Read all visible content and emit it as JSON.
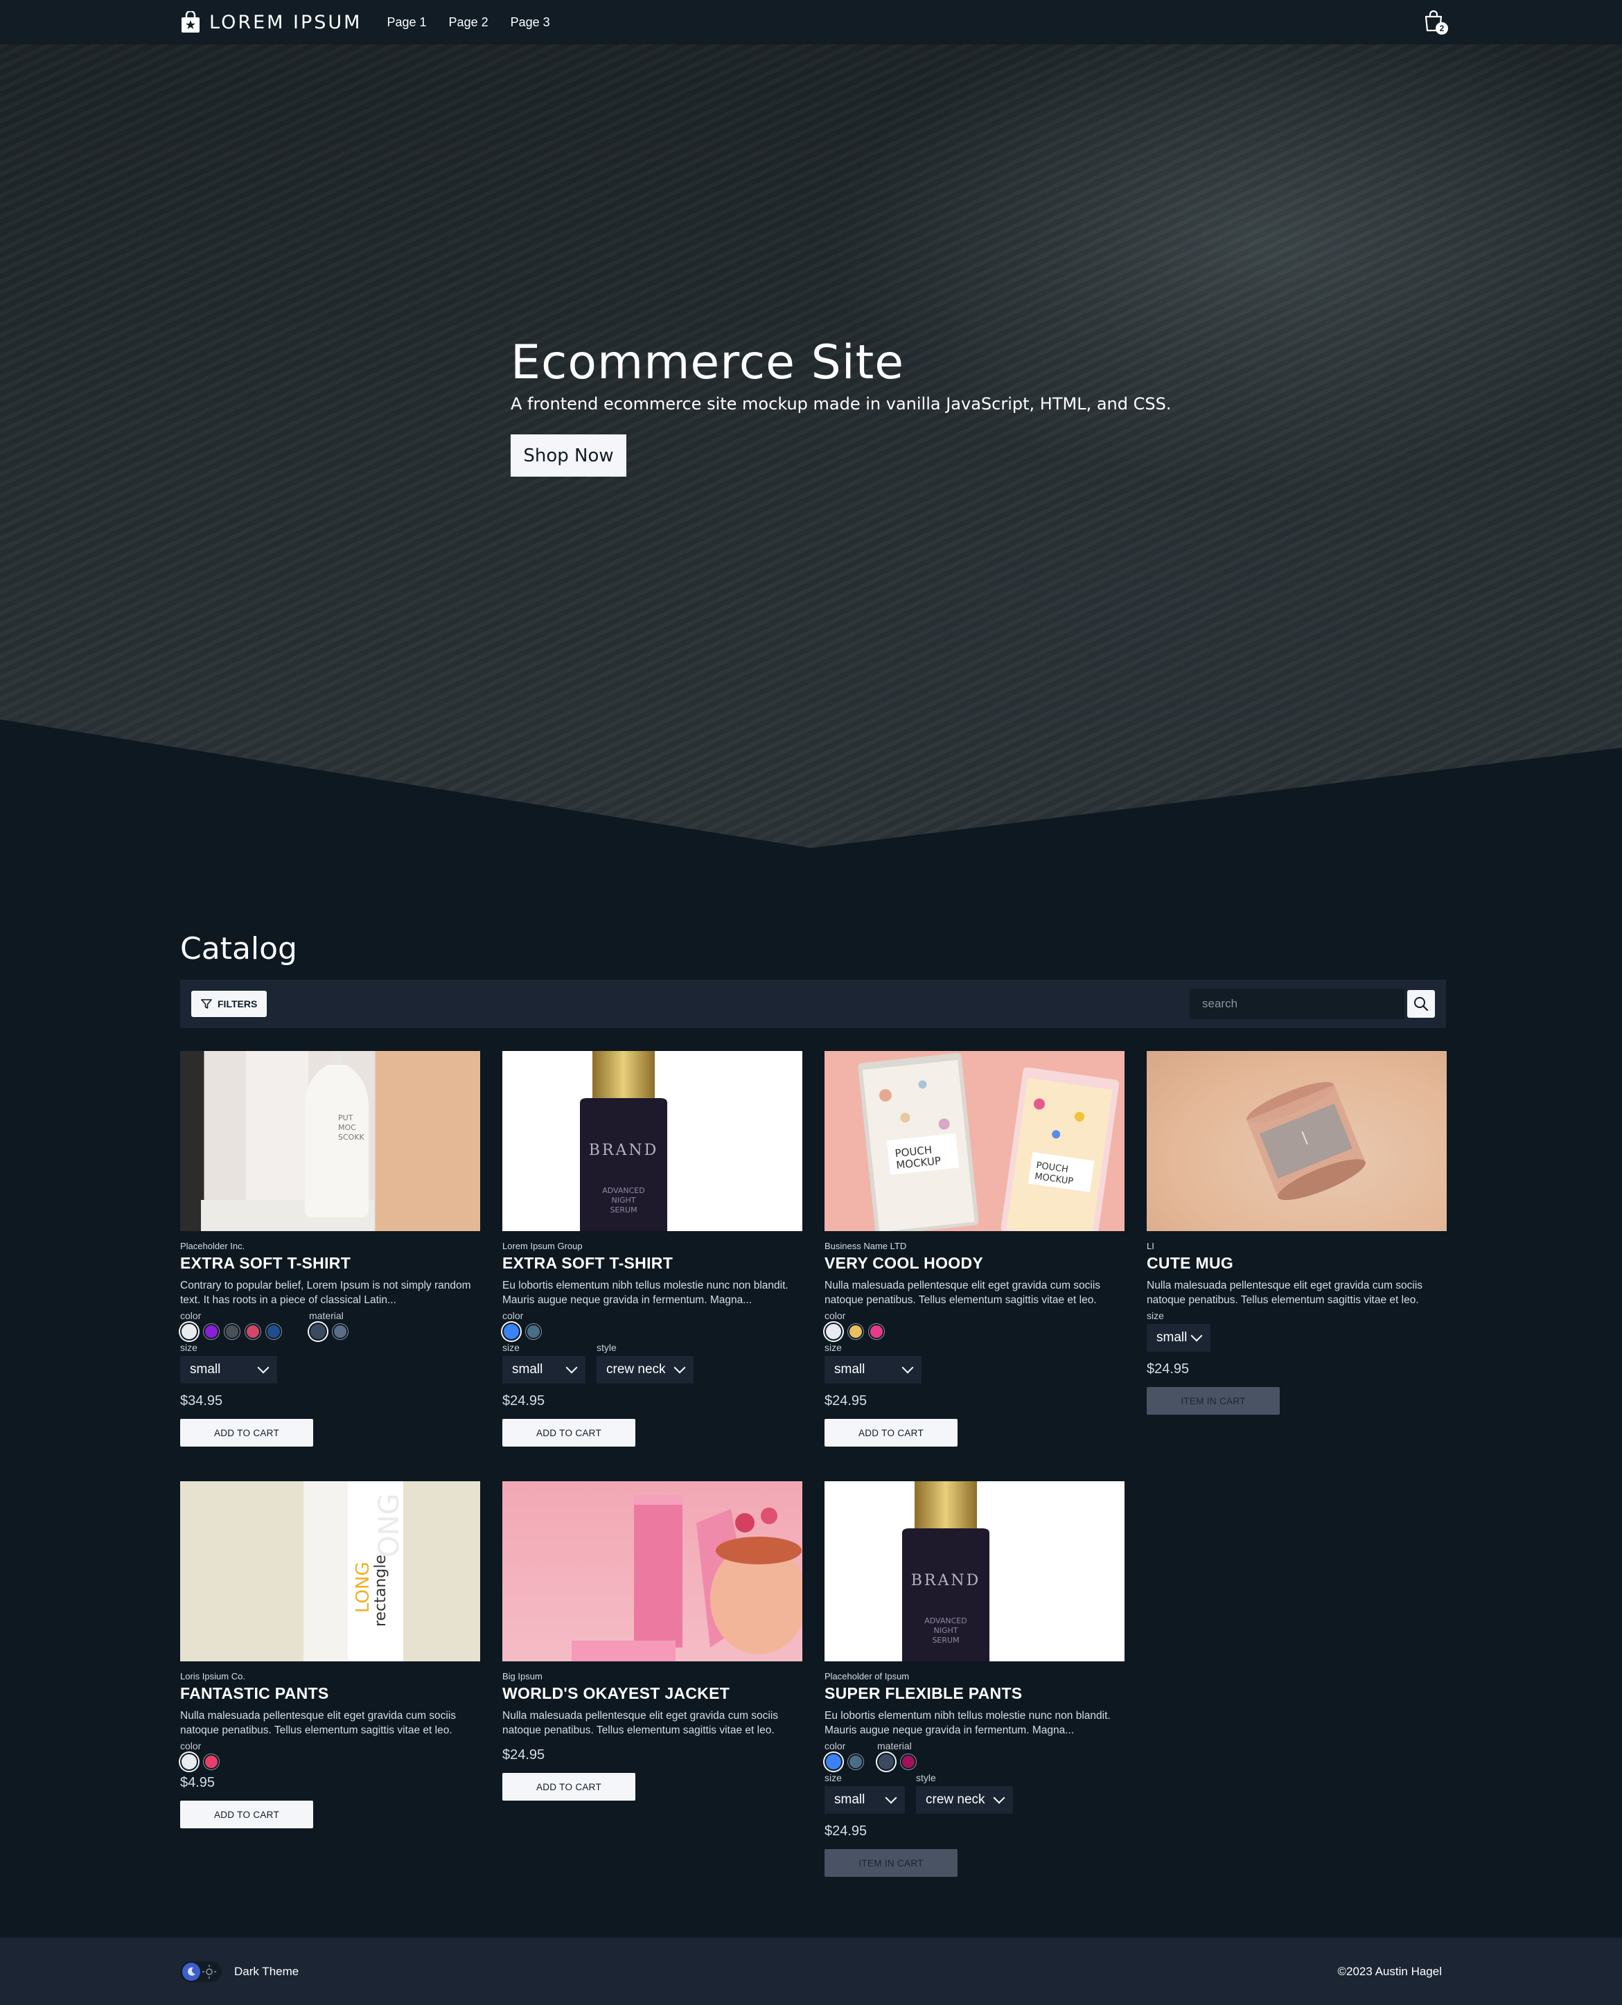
{
  "nav": {
    "brand": "LOREM IPSUM",
    "links": [
      "Page 1",
      "Page 2",
      "Page 3"
    ],
    "cart_count": "2"
  },
  "hero": {
    "title": "Ecommerce Site",
    "subtitle": "A frontend ecommerce site mockup made in vanilla JavaScript, HTML, and CSS.",
    "cta": "Shop Now"
  },
  "catalog": {
    "title": "Catalog",
    "filters_label": "FILTERS",
    "search_placeholder": "search"
  },
  "colors": {
    "background": "#0d1821",
    "nav": "#111c25",
    "toolbar": "#1b2533",
    "button": "#f4f6fa",
    "button_disabled": "#4a5363",
    "toggle_accent": "#3d5fcb"
  },
  "products": [
    {
      "brand": "Placeholder Inc.",
      "name": "EXTRA SOFT T-SHIRT",
      "desc": "Contrary to popular belief, Lorem Ipsum is not simply random text. It has roots in a piece of classical Latin...",
      "color_label": "color",
      "colors": [
        "#e9ebf0",
        "#8b1fd8",
        "#4b5057",
        "#d6456a",
        "#1f4f90"
      ],
      "material_label": "material",
      "materials": [
        "#3b4a5e",
        "#5a6e88"
      ],
      "size_label": "size",
      "size": "small",
      "price": "$34.95",
      "action": "ADD TO CART"
    },
    {
      "brand": "Lorem Ipsum Group",
      "name": "EXTRA SOFT T-SHIRT",
      "desc": "Eu lobortis elementum nibh tellus molestie nunc non blandit. Mauris augue neque gravida in fermentum. Magna...",
      "color_label": "color",
      "colors": [
        "#3b82f6",
        "#4a6e88"
      ],
      "size_label": "size",
      "size": "small",
      "style_label": "style",
      "style": "crew neck",
      "price": "$24.95",
      "action": "ADD TO CART"
    },
    {
      "brand": "Business Name LTD",
      "name": "VERY COOL HOODY",
      "desc": "Nulla malesuada pellentesque elit eget gravida cum sociis natoque penatibus. Tellus elementum sagittis vitae et leo.",
      "color_label": "color",
      "colors": [
        "#e9ebf0",
        "#e9c060",
        "#e83a8a"
      ],
      "size_label": "size",
      "size": "small",
      "price": "$24.95",
      "action": "ADD TO CART"
    },
    {
      "brand": "LI",
      "name": "CUTE MUG",
      "desc": "Nulla malesuada pellentesque elit eget gravida cum sociis natoque penatibus. Tellus elementum sagittis vitae et leo.",
      "size_label": "size",
      "size": "small",
      "price": "$24.95",
      "action": "ITEM IN CART"
    },
    {
      "brand": "Loris Ipsium Co.",
      "name": "FANTASTIC PANTS",
      "desc": "Nulla malesuada pellentesque elit eget gravida cum sociis natoque penatibus. Tellus elementum sagittis vitae et leo.",
      "color_label": "color",
      "colors": [
        "#e9ebf0",
        "#e8406a"
      ],
      "price": "$4.95",
      "action": "ADD TO CART"
    },
    {
      "brand": "Big Ipsum",
      "name": "WORLD'S OKAYEST JACKET",
      "desc": "Nulla malesuada pellentesque elit eget gravida cum sociis natoque penatibus. Tellus elementum sagittis vitae et leo.",
      "price": "$24.95",
      "action": "ADD TO CART"
    },
    {
      "brand": "Placeholder of Ipsum",
      "name": "SUPER FLEXIBLE PANTS",
      "desc": "Eu lobortis elementum nibh tellus molestie nunc non blandit. Mauris augue neque gravida in fermentum. Magna...",
      "color_label": "color",
      "colors": [
        "#3b82f6",
        "#4a6e88"
      ],
      "material_label": "material",
      "materials": [
        "#3b4a5e",
        "#a0125a"
      ],
      "size_label": "size",
      "size": "small",
      "style_label": "style",
      "style": "crew neck",
      "price": "$24.95",
      "action": "ITEM IN CART"
    }
  ],
  "footer": {
    "theme_label": "Dark Theme",
    "copyright": "©2023 Austin Hagel"
  }
}
